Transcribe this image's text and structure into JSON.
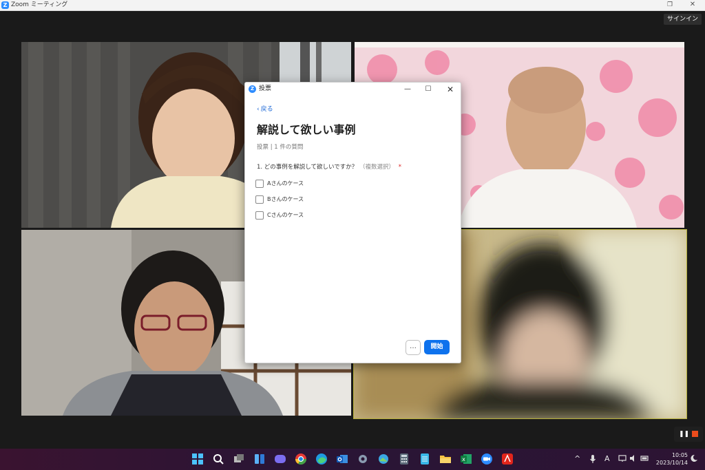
{
  "app": {
    "title": "Zoom ミーティング",
    "signin_label": "サインイン"
  },
  "poll": {
    "window_title": "投票",
    "back_label": "戻る",
    "title": "解説して欲しい事例",
    "meta": "投票 | 1 件の質問",
    "question": "1. どの事例を解説して欲しいですか？",
    "question_hint": "（複数選択）",
    "required_mark": "*",
    "options": [
      {
        "label": "Aさんのケース",
        "checked": false
      },
      {
        "label": "Bさんのケース",
        "checked": false
      },
      {
        "label": "Cさんのケース",
        "checked": false
      }
    ],
    "start_label": "開始"
  },
  "recording": {
    "stop_color": "#ec4c1c"
  },
  "taskbar": {
    "apps": [
      "windows-start",
      "search",
      "task-view",
      "widgets",
      "teams-chat",
      "chrome",
      "edge",
      "outlook",
      "settings",
      "photos",
      "calculator",
      "notepad",
      "file-explorer",
      "excel",
      "zoom",
      "acrobat"
    ],
    "clock_time": "10:05",
    "clock_date": "2023/10/14",
    "ime": "A"
  },
  "colors": {
    "accent": "#0e72ed",
    "zoom_blue": "#2d8cff",
    "active_speaker_border": "#b7b13a"
  }
}
